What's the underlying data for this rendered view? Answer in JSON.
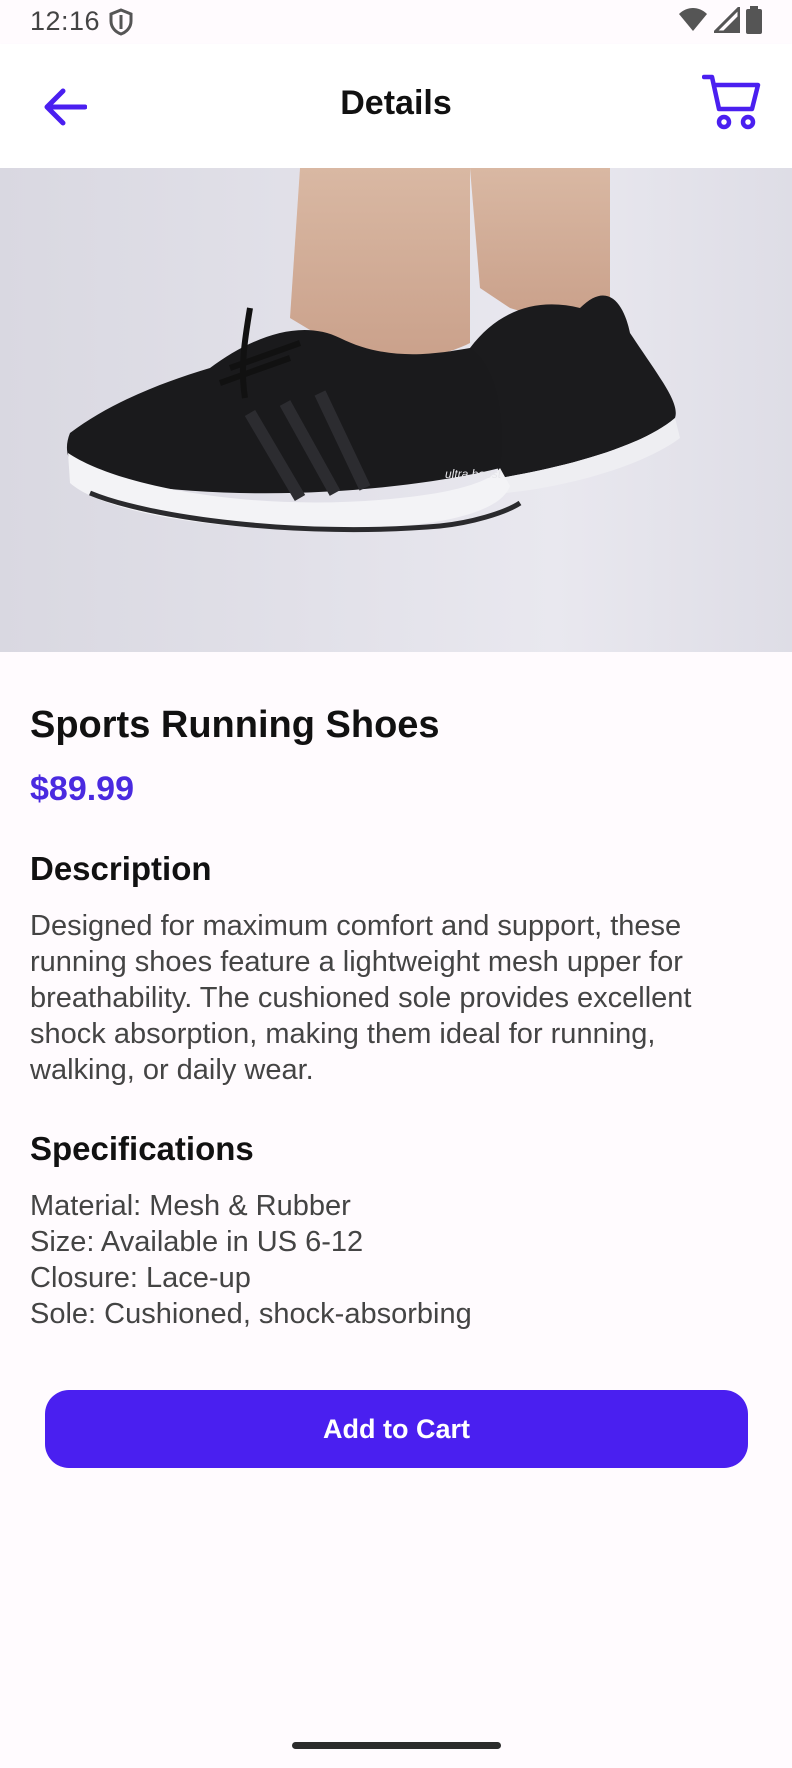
{
  "status_bar": {
    "time": "12:16",
    "icons": [
      "shield-icon",
      "wifi-icon",
      "cell-signal-icon",
      "battery-icon"
    ]
  },
  "app_bar": {
    "title": "Details",
    "back_icon": "arrow-left-icon",
    "cart_icon": "cart-icon"
  },
  "product": {
    "image": "black running shoes worn on feet",
    "name": "Sports Running Shoes",
    "price": "$89.99",
    "description_heading": "Description",
    "description": "Designed for maximum comfort and support, these running shoes feature a lightweight mesh upper for breathability. The cushioned sole provides excellent shock absorption, making them ideal for running, walking, or daily wear.",
    "specs_heading": "Specifications",
    "specs": [
      "Material: Mesh & Rubber",
      "Size: Available in US 6-12",
      "Closure: Lace-up",
      "Sole: Cushioned, shock-absorbing"
    ],
    "shoe_brand_text": "ultra boost"
  },
  "actions": {
    "add_to_cart_label": "Add to Cart"
  },
  "colors": {
    "accent": "#4a1ff0",
    "price": "#4a2ae0",
    "background": "#fffbfe",
    "body_text": "#444444"
  }
}
